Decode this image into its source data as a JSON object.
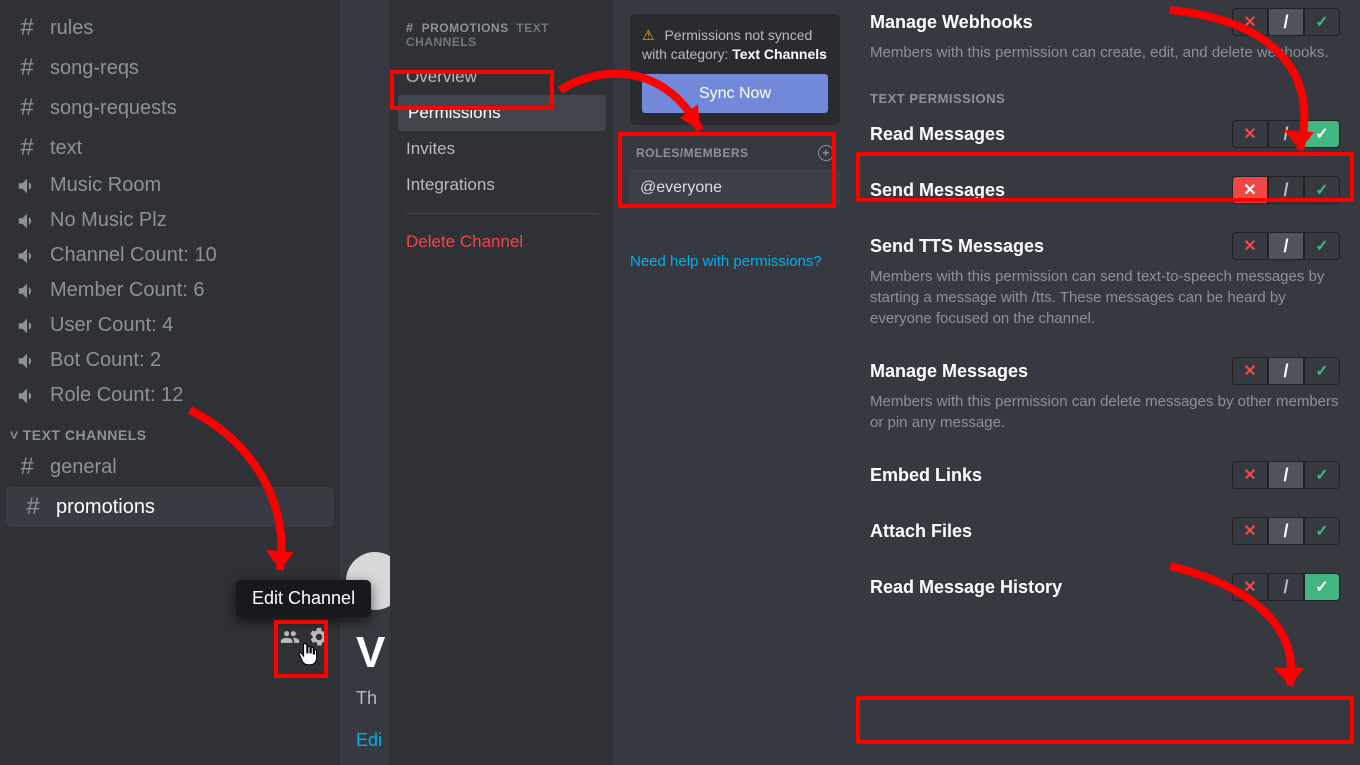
{
  "sidebar": {
    "text_channels_top": [
      "rules",
      "song-reqs",
      "song-requests",
      "text"
    ],
    "voice_channels": [
      "Music Room",
      "No Music Plz",
      "Channel Count: 10",
      "Member Count: 6",
      "User Count: 4",
      "Bot Count: 2",
      "Role Count: 12"
    ],
    "category_label": "TEXT CHANNELS",
    "text_channels_bottom": [
      "general",
      "promotions"
    ],
    "tooltip_edit": "Edit Channel"
  },
  "midnav": {
    "hash": "#",
    "channel_name": "PROMOTIONS",
    "sub_label": "TEXT CHANNELS",
    "items": [
      "Overview",
      "Permissions",
      "Invites",
      "Integrations"
    ],
    "delete": "Delete Channel"
  },
  "roles_panel": {
    "sync_text_a": "Permissions not synced with category: ",
    "sync_text_b": "Text Channels",
    "sync_btn": "Sync Now",
    "roles_header": "ROLES/MEMBERS",
    "role_everyone": "@everyone",
    "help": "Need help with permissions?"
  },
  "perms": {
    "manage_webhooks": {
      "title": "Manage Webhooks",
      "desc": "Members with this permission can create, edit, and delete webhooks.",
      "state": "neutral"
    },
    "section_heading": "TEXT PERMISSIONS",
    "read_messages": {
      "title": "Read Messages",
      "state": "allow"
    },
    "send_messages": {
      "title": "Send Messages",
      "state": "deny"
    },
    "send_tts": {
      "title": "Send TTS Messages",
      "desc": "Members with this permission can send text-to-speech messages by starting a message with /tts. These messages can be heard by everyone focused on the channel.",
      "state": "neutral"
    },
    "manage_messages": {
      "title": "Manage Messages",
      "desc": "Members with this permission can delete messages by other members or pin any message.",
      "state": "neutral"
    },
    "embed_links": {
      "title": "Embed Links",
      "state": "neutral"
    },
    "attach_files": {
      "title": "Attach Files",
      "state": "neutral"
    },
    "read_history": {
      "title": "Read Message History",
      "state": "allow"
    }
  },
  "bottom": {
    "th": "Th",
    "edit": "Edi",
    "w": "V"
  }
}
